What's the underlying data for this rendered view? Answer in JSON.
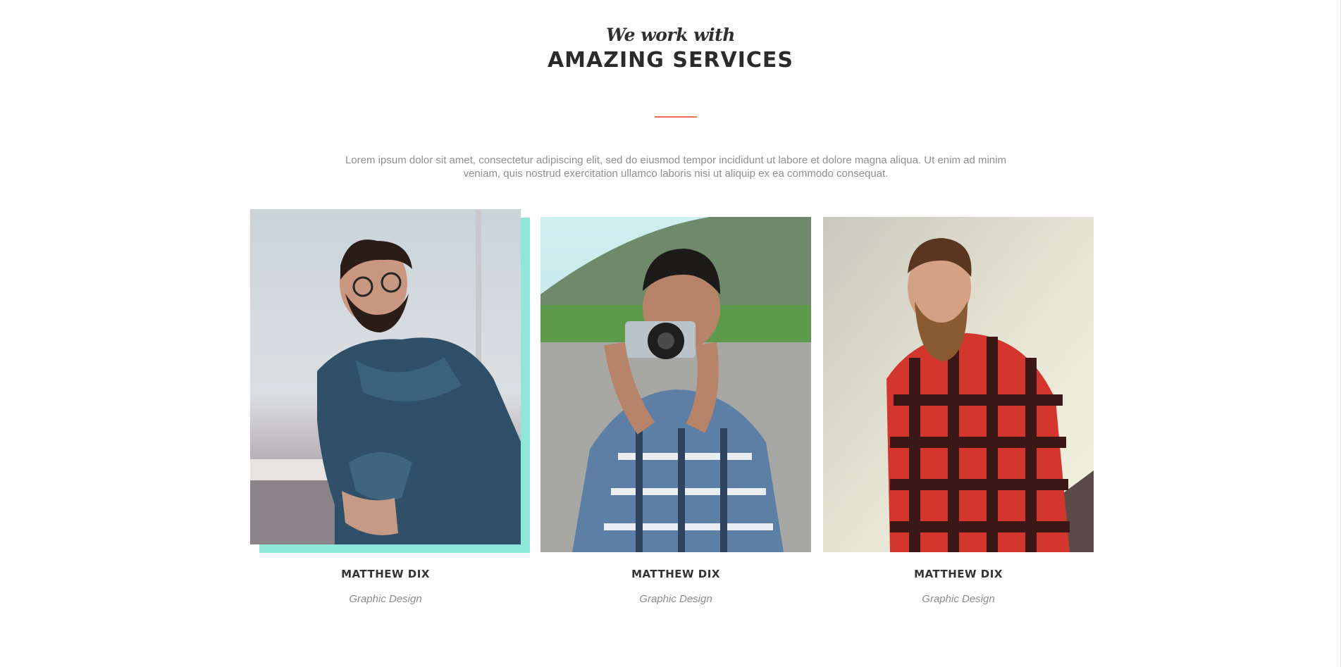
{
  "section": {
    "eyebrow": "We work with",
    "title": "AMAZING SERVICES",
    "intro": "Lorem ipsum dolor sit amet, consectetur adipiscing elit, sed do eiusmod tempor incididunt ut labore et dolore magna aliqua. Ut enim ad minim veniam, quis nostrud exercitation ullamco laboris nisi ut aliquip ex ea commodo consequat.",
    "divider_color": "#f36c5a",
    "accent_shadow_color": "#8fe8d7"
  },
  "team": [
    {
      "name": "MATTHEW DIX",
      "role": "Graphic Design",
      "photo": "man-denim-shirt-glasses-photo"
    },
    {
      "name": "MATTHEW DIX",
      "role": "Graphic Design",
      "photo": "man-holding-camera-plaid-shirt-photo"
    },
    {
      "name": "MATTHEW DIX",
      "role": "Graphic Design",
      "photo": "bearded-man-red-plaid-shirt-photo"
    }
  ]
}
